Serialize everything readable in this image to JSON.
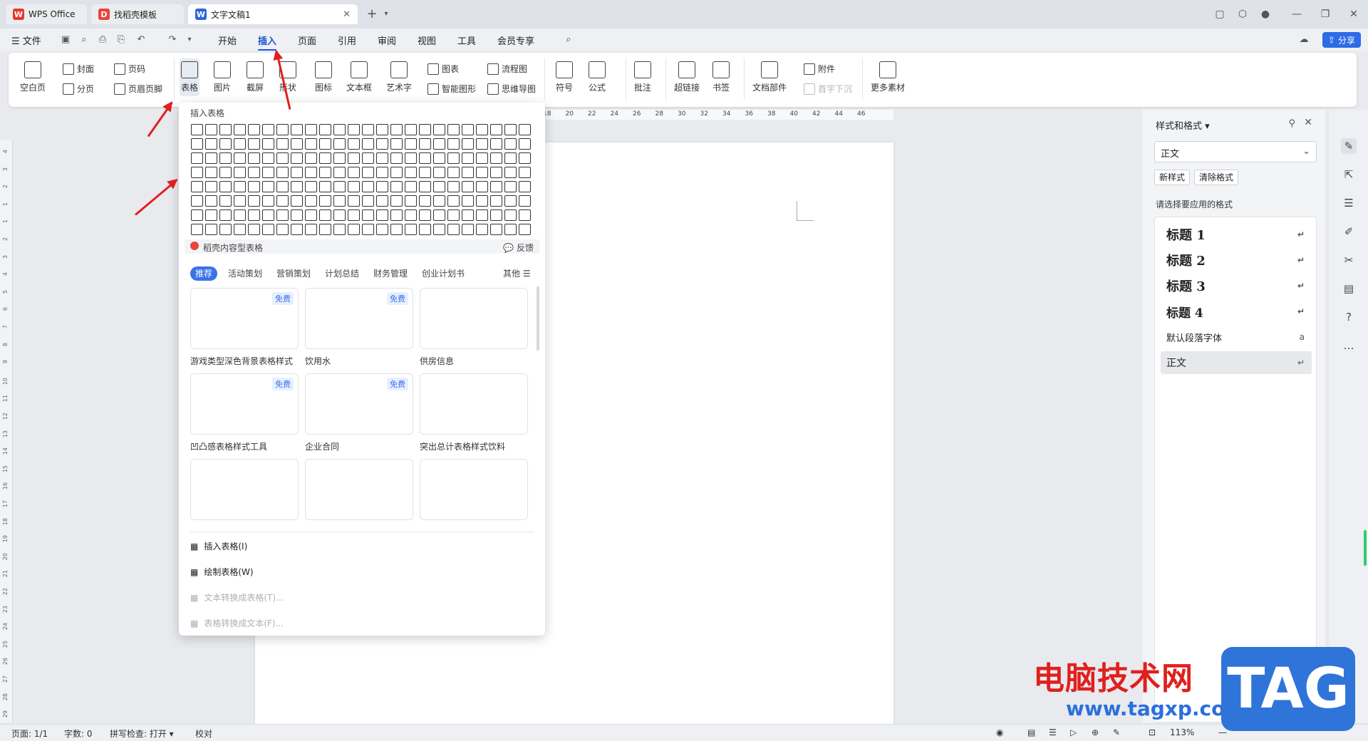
{
  "tabs": [
    {
      "label": "WPS Office",
      "icon": "wps-logo-icon"
    },
    {
      "label": "找稻壳模板",
      "icon": "docer-logo-icon"
    },
    {
      "label": "文字文稿1",
      "icon": "writer-logo-icon"
    }
  ],
  "menu": {
    "file": "文件",
    "items": [
      "开始",
      "插入",
      "页面",
      "引用",
      "审阅",
      "视图",
      "工具",
      "会员专享"
    ],
    "active": "插入",
    "share": "分享"
  },
  "ribbon": {
    "blank_page": "空白页",
    "cover": "封面",
    "page_break": "分页",
    "page_number": "页码",
    "header_footer": "页眉页脚",
    "table": "表格",
    "picture": "图片",
    "screenshot": "截屏",
    "shape": "形状",
    "icon": "图标",
    "textbox": "文本框",
    "wordart": "艺术字",
    "chart": "图表",
    "smartart": "智能图形",
    "flowchart": "流程图",
    "mindmap": "思维导图",
    "symbol": "符号",
    "formula": "公式",
    "comment": "批注",
    "hyperlink": "超链接",
    "bookmark": "书签",
    "doc_parts": "文档部件",
    "attachment": "附件",
    "drop_cap": "首字下沉",
    "more_material": "更多素材"
  },
  "ruler": {
    "h_ticks": [
      "18",
      "20",
      "22",
      "24",
      "26",
      "28",
      "30",
      "32",
      "34",
      "36",
      "38",
      "40",
      "42",
      "44",
      "46"
    ],
    "v_ticks": [
      "4",
      "3",
      "2",
      "1",
      "1",
      "2",
      "3",
      "4",
      "5",
      "6",
      "7",
      "8",
      "9",
      "10",
      "11",
      "12",
      "13",
      "14",
      "15",
      "16",
      "17",
      "18",
      "19",
      "20",
      "21",
      "22",
      "23",
      "24",
      "25",
      "26",
      "27",
      "28",
      "29"
    ]
  },
  "dropdown": {
    "title": "插入表格",
    "grid_rows": 8,
    "grid_cols": 24,
    "docer_title": "稻壳内容型表格",
    "feedback": "反馈",
    "categories": [
      "推荐",
      "活动策划",
      "营销策划",
      "计划总结",
      "财务管理",
      "创业计划书"
    ],
    "other": "其他",
    "free_label": "免费",
    "templates": [
      {
        "name": "游戏类型深色背景表格样式",
        "free": true
      },
      {
        "name": "饮用水",
        "free": true
      },
      {
        "name": "供房信息",
        "free": false
      },
      {
        "name": "凹凸感表格样式工具",
        "free": true
      },
      {
        "name": "企业合同",
        "free": true
      },
      {
        "name": "突出总计表格样式饮料",
        "free": false
      },
      {
        "name": "",
        "free": false
      },
      {
        "name": "",
        "free": false
      },
      {
        "name": "",
        "free": false
      }
    ],
    "actions": [
      {
        "label": "插入表格(I)",
        "disabled": false
      },
      {
        "label": "绘制表格(W)",
        "disabled": false
      },
      {
        "label": "文本转换成表格(T)...",
        "disabled": true
      },
      {
        "label": "表格转换成文本(F)...",
        "disabled": true
      }
    ]
  },
  "style_pane": {
    "title": "样式和格式",
    "current": "正文",
    "new_style": "新样式",
    "clear_format": "清除格式",
    "choose_label": "请选择要应用的格式",
    "styles": [
      "标题 1",
      "标题 2",
      "标题 3",
      "标题 4",
      "默认段落字体",
      "正文"
    ]
  },
  "status": {
    "page": "页面: 1/1",
    "words": "字数: 0",
    "spell": "拼写检查: 打开",
    "proof": "校对",
    "zoom": "113%"
  },
  "watermark": {
    "cn": "电脑技术网",
    "url": "www.tagxp.com",
    "tag": "TAG"
  },
  "colors": {
    "accent": "#1a56d6",
    "arrow": "#e02020"
  }
}
